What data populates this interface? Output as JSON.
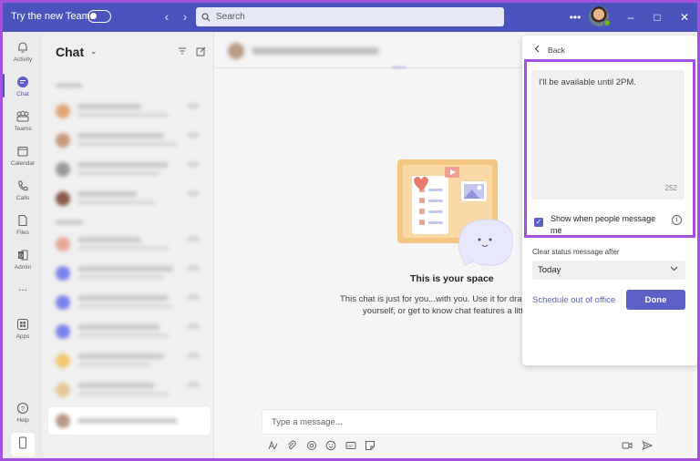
{
  "titlebar": {
    "try_new_teams": "Try the new Teams",
    "search_placeholder": "Search"
  },
  "rail": {
    "items": [
      {
        "label": "Activity",
        "icon": "bell-icon"
      },
      {
        "label": "Chat",
        "icon": "chat-icon"
      },
      {
        "label": "Teams",
        "icon": "teams-icon"
      },
      {
        "label": "Calendar",
        "icon": "calendar-icon"
      },
      {
        "label": "Calls",
        "icon": "phone-icon"
      },
      {
        "label": "Files",
        "icon": "file-icon"
      },
      {
        "label": "Admin",
        "icon": "office-icon"
      },
      {
        "label": "Apps",
        "icon": "apps-icon"
      },
      {
        "label": "Help",
        "icon": "help-icon"
      }
    ],
    "more": "..."
  },
  "chat_list": {
    "title": "Chat"
  },
  "main": {
    "space_title": "This is your space",
    "space_desc_line1": "This chat is just for you...with you. Use it for drafts",
    "space_desc_line2": "yourself, or get to know chat features a little",
    "compose_placeholder": "Type a message..."
  },
  "status_popup": {
    "back_label": "Back",
    "status_message": "I'll be available until 2PM.",
    "char_count": "252",
    "show_when_label": "Show when people message me",
    "show_when_checked": true,
    "clear_after_label": "Clear status message after",
    "clear_after_value": "Today",
    "schedule_link": "Schedule out of office",
    "done_label": "Done"
  },
  "colors": {
    "accent": "#5b5fc7",
    "titlebar": "#4b53bc",
    "highlight": "#a451e0"
  }
}
